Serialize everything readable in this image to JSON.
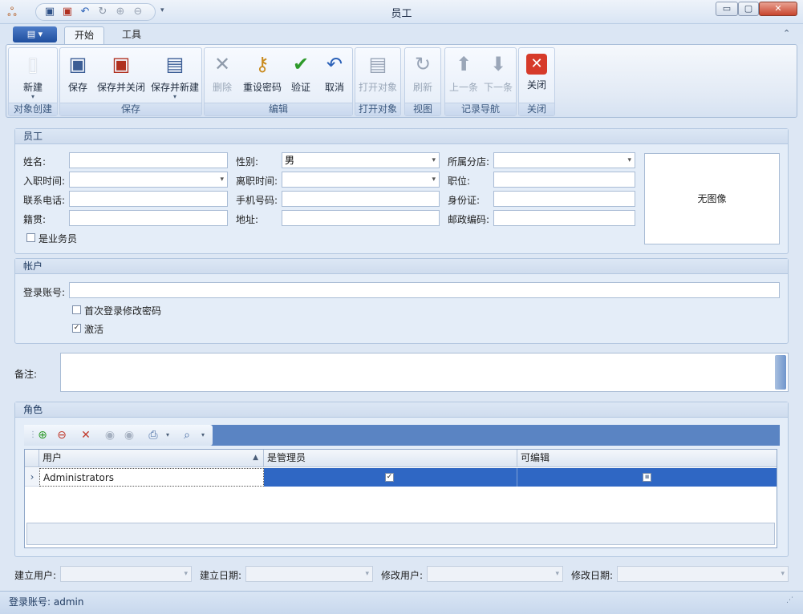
{
  "window": {
    "title": "员工"
  },
  "ribbon": {
    "tabs": {
      "start": "开始",
      "tools": "工具"
    },
    "groups": {
      "create": {
        "label": "对象创建",
        "new": "新建"
      },
      "save": {
        "label": "保存",
        "save": "保存",
        "save_close": "保存并关闭",
        "save_new": "保存并新建"
      },
      "edit": {
        "label": "编辑",
        "delete": "删除",
        "reset_password": "重设密码",
        "validate": "验证",
        "cancel": "取消"
      },
      "open": {
        "label": "打开对象",
        "open": "打开对象"
      },
      "view": {
        "label": "视图",
        "refresh": "刷新"
      },
      "nav": {
        "label": "记录导航",
        "prev": "上一条",
        "next": "下一条"
      },
      "close": {
        "label": "关闭",
        "close": "关闭"
      }
    }
  },
  "employee": {
    "title": "员工",
    "labels": {
      "name": "姓名:",
      "gender": "性别:",
      "branch": "所属分店:",
      "join": "入职时间:",
      "leave": "离职时间:",
      "position": "职位:",
      "phone": "联系电话:",
      "mobile": "手机号码:",
      "id_card": "身份证:",
      "native": "籍贯:",
      "address": "地址:",
      "postcode": "邮政编码:"
    },
    "values": {
      "gender": "男"
    },
    "is_salesman": "是业务员",
    "no_image": "无图像"
  },
  "account": {
    "title": "帐户",
    "login_label": "登录账号:",
    "change_pwd_first": "首次登录修改密码",
    "active": "激活"
  },
  "remark": {
    "label": "备注:"
  },
  "roles": {
    "title": "角色",
    "columns": {
      "user": "用户",
      "is_admin": "是管理员",
      "editable": "可编辑"
    },
    "rows": [
      {
        "user": "Administrators"
      }
    ]
  },
  "footer": {
    "created_user": "建立用户:",
    "created_date": "建立日期:",
    "modified_user": "修改用户:",
    "modified_date": "修改日期:"
  },
  "status": {
    "login": "登录账号: admin"
  },
  "colors": {
    "accent": "#2f67c4",
    "toolbar": "#5a84c3"
  }
}
